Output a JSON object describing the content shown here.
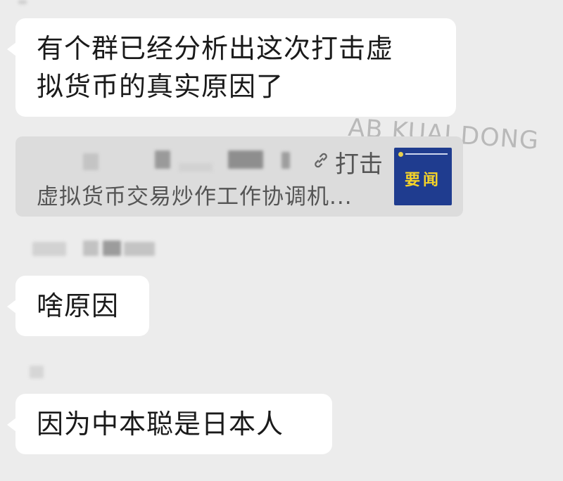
{
  "messages": [
    {
      "text_line1": "有个群已经分析出这次打击虚",
      "text_line2": "拟货币的真实原因了"
    },
    {
      "text": "啥原因"
    },
    {
      "text": "因为中本聪是日本人"
    }
  ],
  "link_card": {
    "title_suffix": "打击",
    "link_icon": "link-icon",
    "description": "虚拟货币交易炒作工作协调机...",
    "thumbnail_label": "要闻"
  },
  "watermark": "AB KUAI DONG",
  "colors": {
    "background": "#ececec",
    "bubble": "#ffffff",
    "card": "#dcdcdc",
    "thumbnail": "#1f3c8f",
    "thumbnail_text": "#f5d329"
  }
}
